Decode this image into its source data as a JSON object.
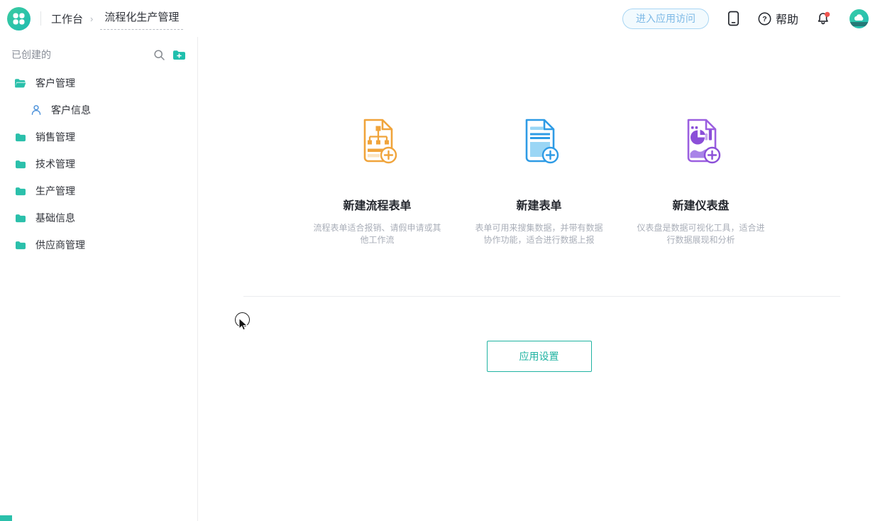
{
  "header": {
    "breadcrumb": {
      "home": "工作台",
      "separator": "›",
      "current": "流程化生产管理"
    },
    "enter_app_button": "进入应用访问",
    "help_label": "帮助",
    "has_notification_dot": true
  },
  "sidebar": {
    "section_title": "已创建的",
    "items": [
      {
        "label": "客户管理",
        "icon": "folder-open-icon",
        "indent": 0
      },
      {
        "label": "客户信息",
        "icon": "user-icon",
        "indent": 1
      },
      {
        "label": "销售管理",
        "icon": "folder-icon",
        "indent": 0
      },
      {
        "label": "技术管理",
        "icon": "folder-icon",
        "indent": 0
      },
      {
        "label": "生产管理",
        "icon": "folder-icon",
        "indent": 0
      },
      {
        "label": "基础信息",
        "icon": "folder-icon",
        "indent": 0
      },
      {
        "label": "供应商管理",
        "icon": "folder-icon",
        "indent": 0
      }
    ]
  },
  "main": {
    "cards": [
      {
        "icon": "flow-form-doc-icon",
        "title": "新建流程表单",
        "description": "流程表单适合报销、请假申请或其他工作流",
        "color": "#F0A43B"
      },
      {
        "icon": "form-doc-icon",
        "title": "新建表单",
        "description": "表单可用来搜集数据，并带有数据协作功能，适合进行数据上报",
        "color": "#2E9BE5"
      },
      {
        "icon": "dashboard-doc-icon",
        "title": "新建仪表盘",
        "description": "仪表盘是数据可视化工具，适合进行数据展现和分析",
        "color": "#8B4FD8"
      }
    ],
    "app_settings_button": "应用设置"
  },
  "colors": {
    "brand_teal": "#2BC0AB",
    "flow_orange": "#F0A43B",
    "form_blue": "#2E9BE5",
    "dashboard_purple": "#8B4FD8",
    "enter_app_blue": "#7DB9E6",
    "notification_red": "#F0544F",
    "settings_teal": "#21B3A2"
  }
}
